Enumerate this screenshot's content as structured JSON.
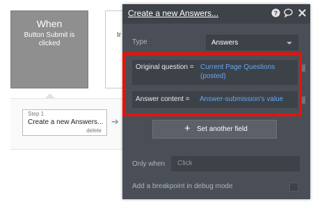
{
  "canvas": {
    "event": {
      "when": "When",
      "description": "Button Submit is clicked"
    },
    "event2": {
      "partial_text": "Ir"
    },
    "step": {
      "number": "Step 1",
      "title": "Create a new Answers...",
      "delete": "delete"
    },
    "arrow": "➔"
  },
  "editor": {
    "title": "Create a new Answers...",
    "type_label": "Type",
    "type_value": "Answers",
    "fields": [
      {
        "label": "Original question =",
        "value": "Current Page Questions (posted)"
      },
      {
        "label": "Answer content =",
        "value": "Answer-submission's value"
      }
    ],
    "set_another_field": {
      "plus": "+",
      "label": "Set another field"
    },
    "only_when_label": "Only when",
    "only_when_placeholder": "Click",
    "breakpoint_label": "Add a breakpoint in debug mode"
  },
  "colors": {
    "highlight": "#e3140c",
    "link_blue": "#63a9f5",
    "panel_bg": "#4a4f57"
  }
}
